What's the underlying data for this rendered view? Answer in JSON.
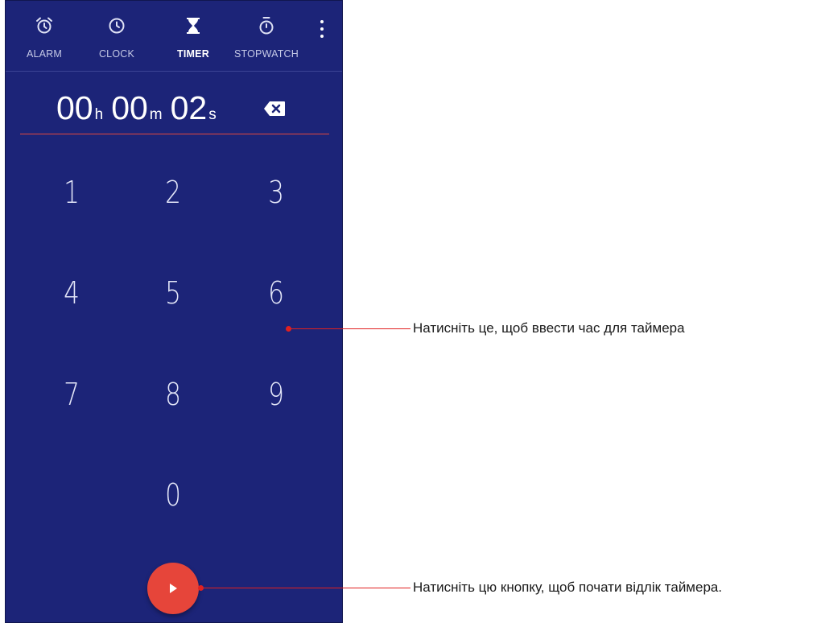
{
  "tabs": [
    {
      "label": "ALARM",
      "icon": "alarm-icon"
    },
    {
      "label": "CLOCK",
      "icon": "clock-icon"
    },
    {
      "label": "TIMER",
      "icon": "hourglass-icon",
      "active": true
    },
    {
      "label": "STOPWATCH",
      "icon": "stopwatch-icon"
    }
  ],
  "timer": {
    "hours": "00",
    "hours_unit": "h",
    "minutes": "00",
    "minutes_unit": "m",
    "seconds": "02",
    "seconds_unit": "s"
  },
  "keypad": [
    "1",
    "2",
    "3",
    "4",
    "5",
    "6",
    "7",
    "8",
    "9",
    "0"
  ],
  "callouts": {
    "keypad": "Натисніть це, щоб ввести час для таймера",
    "start": "Натисніть цю кнопку, щоб почати відлік таймера."
  },
  "colors": {
    "background": "#1c2478",
    "accent": "#e6453a",
    "underline": "#e2483d",
    "callout": "#e02020"
  }
}
